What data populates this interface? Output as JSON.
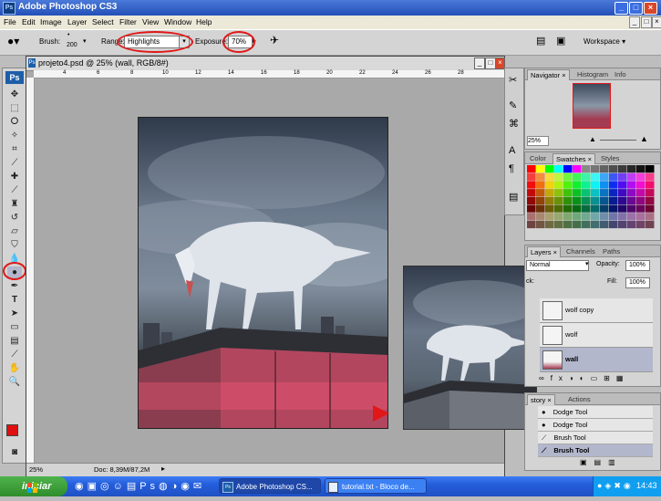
{
  "window": {
    "title": "Adobe Photoshop CS3",
    "app_icon": "Ps"
  },
  "menu": [
    "File",
    "Edit",
    "Image",
    "Layer",
    "Select",
    "Filter",
    "View",
    "Window",
    "Help"
  ],
  "options": {
    "brush_label": "Brush:",
    "brush_size": "200",
    "range_label": "Range:",
    "range_value": "Highlights",
    "exposure_label": "Exposure:",
    "exposure_value": "70%",
    "workspace_label": "Workspace"
  },
  "document": {
    "title": "projeto4.psd @ 25% (wall, RGB/8#)",
    "zoom": "25%",
    "doc_info": "Doc: 8,39M/87,2M",
    "ruler_numbers": [
      "4",
      "6",
      "8",
      "10",
      "12",
      "14",
      "16",
      "18",
      "20",
      "22",
      "24",
      "26",
      "28"
    ]
  },
  "navigator": {
    "tabs": [
      "Navigator",
      "Histogram",
      "Info"
    ],
    "zoom": "25%"
  },
  "swatches": {
    "tabs": [
      "Color",
      "Swatches",
      "Styles"
    ]
  },
  "layers": {
    "tabs": [
      "Layers",
      "Channels",
      "Paths"
    ],
    "blend_mode": "Normal",
    "opacity_label": "Opacity:",
    "opacity": "100%",
    "lock_label": "ck:",
    "fill_label": "Fill:",
    "fill": "100%",
    "items": [
      {
        "name": "wolf copy",
        "selected": false
      },
      {
        "name": "wolf",
        "selected": false
      },
      {
        "name": "wall",
        "selected": true
      }
    ]
  },
  "history": {
    "tabs": [
      "story",
      "Actions"
    ],
    "items": [
      {
        "name": "Dodge Tool",
        "selected": false
      },
      {
        "name": "Dodge Tool",
        "selected": false
      },
      {
        "name": "Brush Tool",
        "selected": false
      },
      {
        "name": "Brush Tool",
        "selected": true
      }
    ]
  },
  "taskbar": {
    "start": "iniciar",
    "tasks": [
      "Adobe Photoshop CS...",
      "tutorial.txt - Bloco de..."
    ],
    "clock": "14:43"
  },
  "colors": {
    "foreground": "#e01010",
    "background": "#000000",
    "accent_red": "#e01818",
    "title_blue": "#2350b8"
  }
}
